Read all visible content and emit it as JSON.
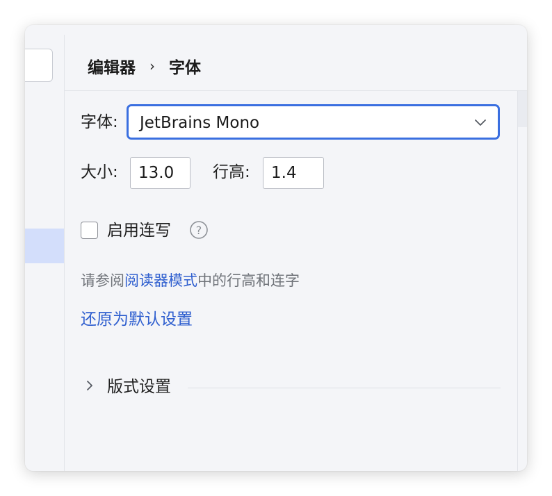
{
  "breadcrumb": {
    "parent": "编辑器",
    "separator": "›",
    "current": "字体"
  },
  "font": {
    "label": "字体:",
    "value": "JetBrains Mono"
  },
  "size": {
    "label": "大小:",
    "value": "13.0"
  },
  "line_height": {
    "label": "行高:",
    "value": "1.4"
  },
  "ligatures": {
    "label": "启用连写",
    "checked": false
  },
  "hint": {
    "prefix": "请参阅",
    "link": "阅读器模式",
    "suffix": "中的行高和连字"
  },
  "reset_link": "还原为默认设置",
  "section": {
    "label": "版式设置",
    "expanded": false
  },
  "colors": {
    "accent": "#3a6fe0",
    "link": "#2f5fcf",
    "selection": "#d3defb"
  },
  "icons": [
    "chevron-down-icon",
    "help-icon",
    "chevron-right-icon"
  ]
}
